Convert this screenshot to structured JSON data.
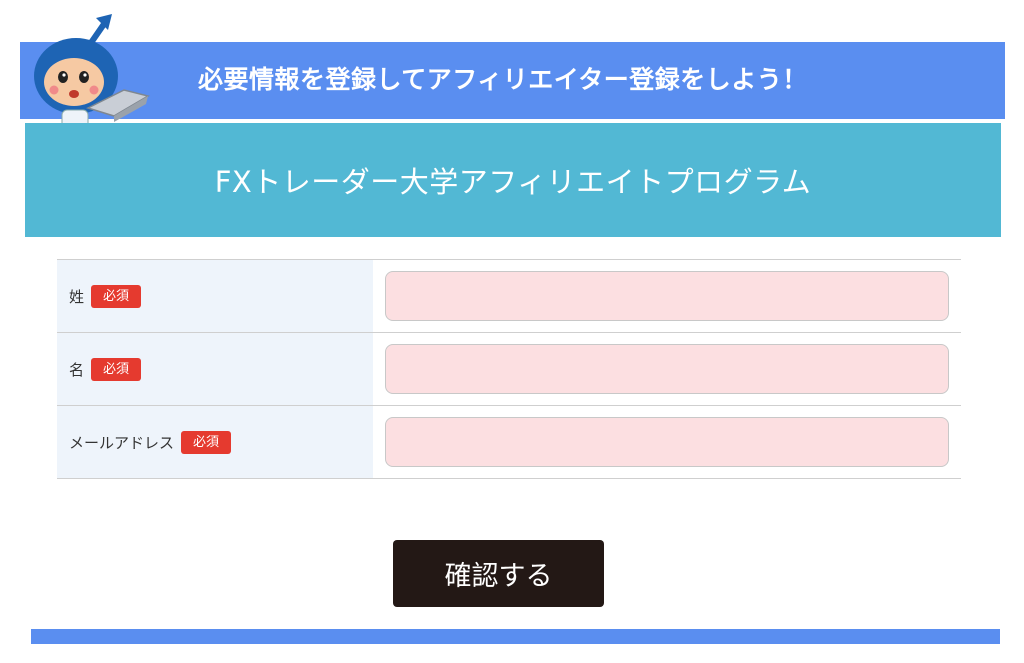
{
  "banner": {
    "text": "必要情報を登録してアフィリエイター登録をしよう！"
  },
  "program": {
    "title": "FXトレーダー大学アフィリエイトプログラム"
  },
  "form": {
    "required_badge": "必須",
    "fields": [
      {
        "label": "姓",
        "value": "",
        "placeholder": ""
      },
      {
        "label": "名",
        "value": "",
        "placeholder": ""
      },
      {
        "label": "メールアドレス",
        "value": "",
        "placeholder": ""
      }
    ]
  },
  "actions": {
    "confirm_label": "確認する"
  },
  "colors": {
    "banner": "#5a8ef0",
    "program_bar": "#52b8d4",
    "badge": "#e53a2f",
    "input_bg": "#fcdfe1",
    "button": "#231815"
  },
  "icons": {
    "mascot": "mascot-with-laptop-icon"
  }
}
